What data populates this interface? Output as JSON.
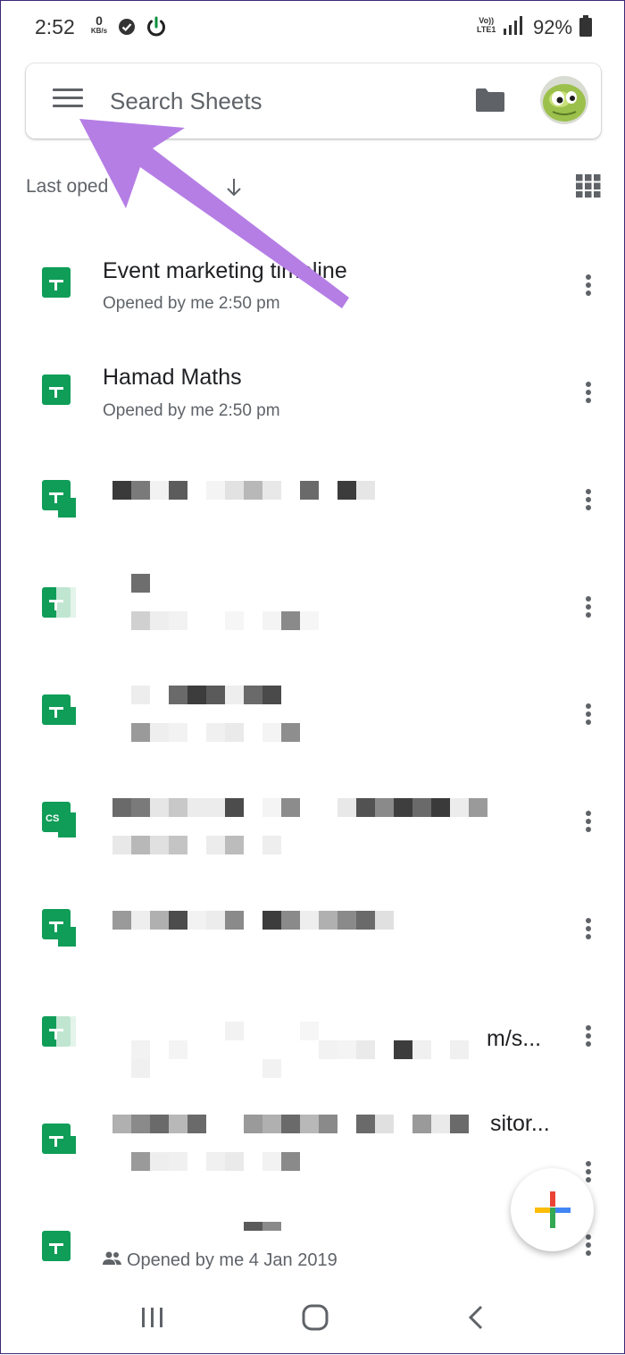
{
  "status_bar": {
    "time": "2:52",
    "net_speed_value": "0",
    "net_speed_unit": "KB/s",
    "volte_label": "Vo)) LTE1",
    "battery_percent": "92%"
  },
  "search": {
    "placeholder": "Search Sheets"
  },
  "sort": {
    "label": "Last opened by me",
    "visible_label": "Last oped"
  },
  "files": [
    {
      "title": "Event marketing timeline",
      "subtitle": "Opened by me 2:50 pm",
      "icon": "sheets-icon"
    },
    {
      "title": "Hamad Maths",
      "subtitle": "Opened by me 2:50 pm",
      "icon": "sheets-icon"
    },
    {
      "title": "",
      "subtitle": "",
      "icon": "sheets-icon"
    },
    {
      "title": "",
      "subtitle": "",
      "icon": "sheets-icon"
    },
    {
      "title": "",
      "subtitle": "",
      "icon": "sheets-icon"
    },
    {
      "title": "",
      "subtitle": "",
      "icon": "csv-sheets-icon"
    },
    {
      "title": "",
      "subtitle": "",
      "icon": "sheets-icon"
    },
    {
      "title": "m/s...",
      "subtitle": "",
      "icon": "sheets-icon"
    },
    {
      "title": "sitor...",
      "subtitle": "",
      "icon": "sheets-icon"
    },
    {
      "title": "",
      "subtitle": "Opened by me 4 Jan 2019",
      "icon": "sheets-icon"
    }
  ],
  "csv_badge": "CS",
  "colors": {
    "sheets_green": "#0f9d58",
    "annotation_arrow": "#b57ee5",
    "fab_red": "#ea4335",
    "fab_yellow": "#fbbc04",
    "fab_green": "#34a853",
    "fab_blue": "#4285f4"
  }
}
